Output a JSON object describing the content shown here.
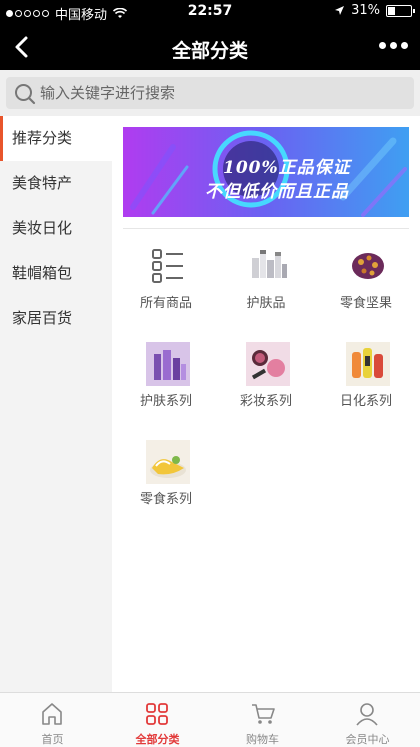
{
  "status_bar": {
    "carrier": "中国移动",
    "time": "22:57",
    "battery": "31%"
  },
  "nav": {
    "title": "全部分类"
  },
  "search": {
    "placeholder": "输入关键字进行搜索"
  },
  "sidebar": {
    "items": [
      {
        "label": "推荐分类",
        "active": true
      },
      {
        "label": "美食特产"
      },
      {
        "label": "美妆日化"
      },
      {
        "label": "鞋帽箱包"
      },
      {
        "label": "家居百货"
      }
    ]
  },
  "banner": {
    "line1": "100%正品保证",
    "line2": "不但低价而且正品"
  },
  "categories": [
    {
      "label": "所有商品",
      "icon": "grid-list-icon"
    },
    {
      "label": "护肤品",
      "icon": "skincare-image"
    },
    {
      "label": "零食坚果",
      "icon": "snack-nuts-image"
    },
    {
      "label": "护肤系列",
      "icon": "skincare-series-image"
    },
    {
      "label": "彩妆系列",
      "icon": "makeup-series-image"
    },
    {
      "label": "日化系列",
      "icon": "daily-chemical-image"
    },
    {
      "label": "零食系列",
      "icon": "snack-series-image"
    }
  ],
  "tabs": [
    {
      "label": "首页",
      "icon": "home-icon"
    },
    {
      "label": "全部分类",
      "icon": "categories-icon",
      "active": true
    },
    {
      "label": "购物车",
      "icon": "cart-icon"
    },
    {
      "label": "会员中心",
      "icon": "member-icon"
    }
  ],
  "colors": {
    "accent": "#e23a3a",
    "sidebar_marker": "#e8552b"
  }
}
